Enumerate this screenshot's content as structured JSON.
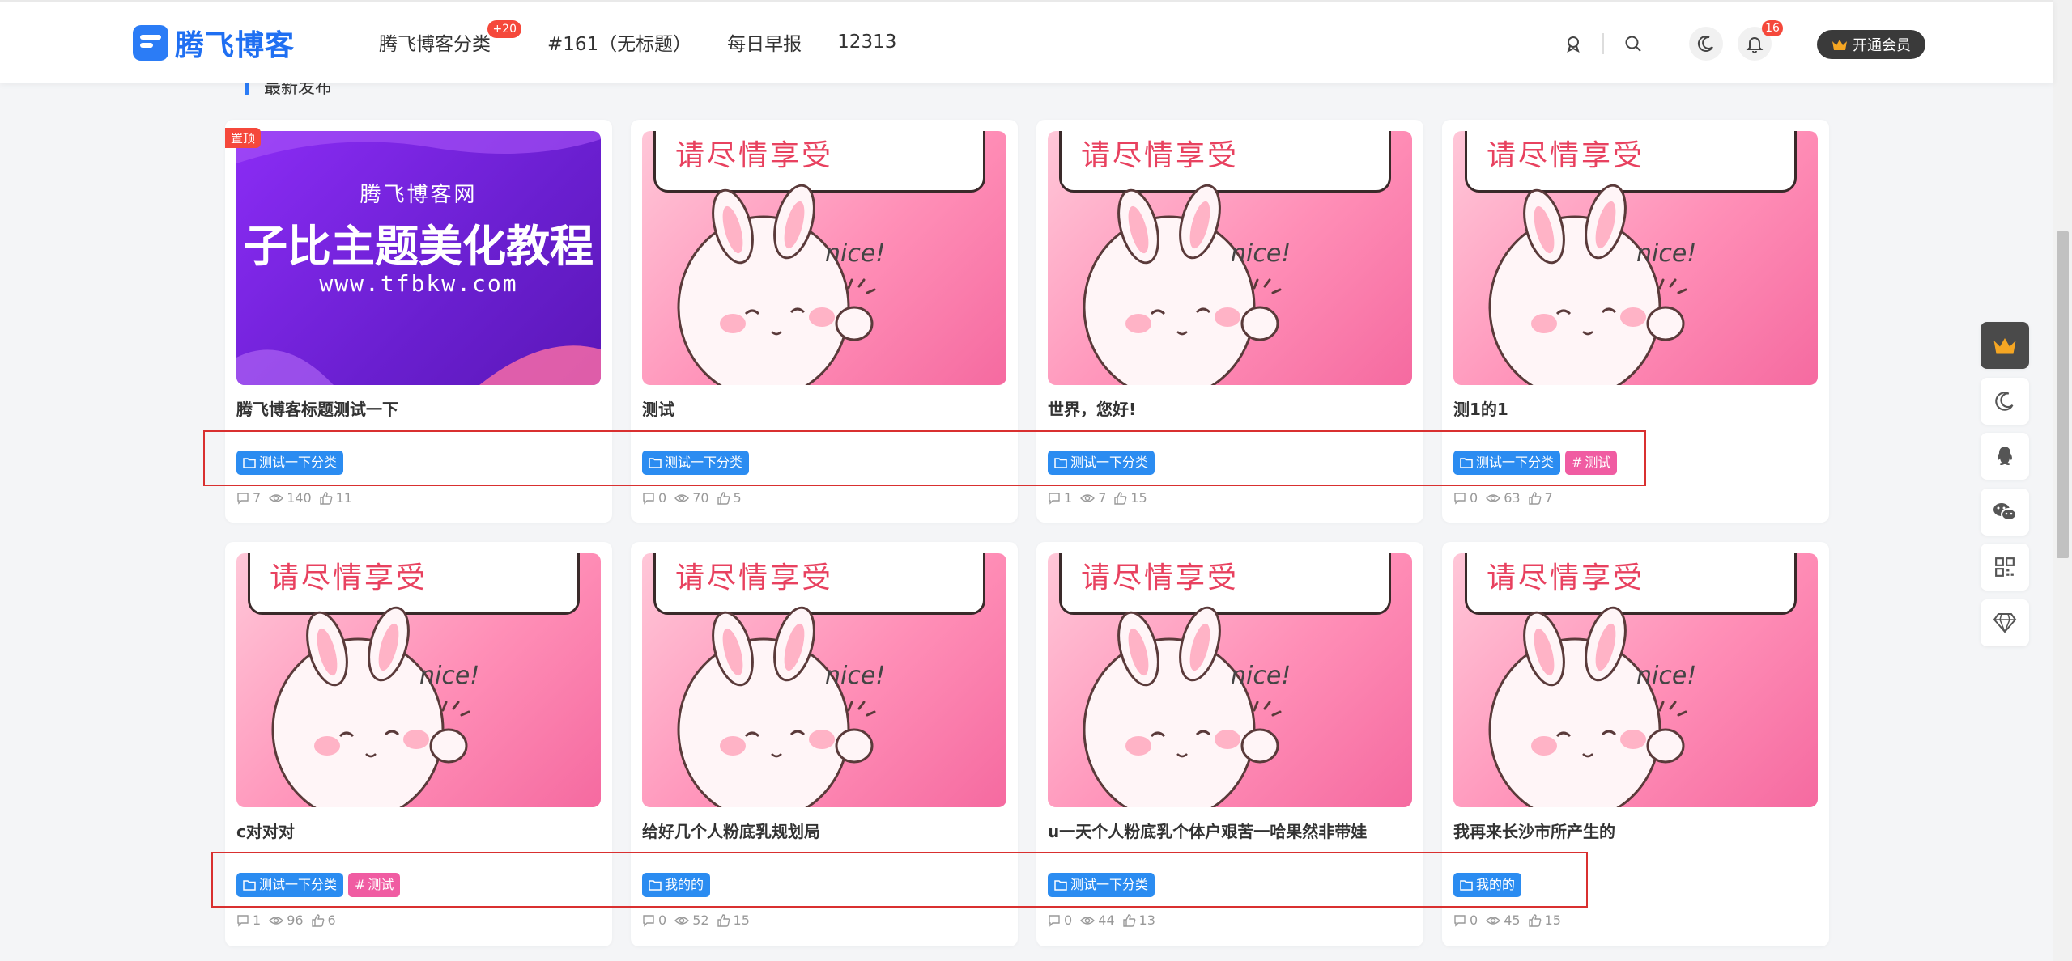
{
  "header": {
    "logo_text": "腾飞博客",
    "nav": [
      {
        "label": "腾飞博客分类",
        "badge": "+20"
      },
      {
        "label": "#161（无标题）"
      },
      {
        "label": "每日早报"
      },
      {
        "label": "12313"
      }
    ],
    "notification_count": "16",
    "vip_label": "开通会员"
  },
  "section": {
    "title": "最新发布"
  },
  "cards": [
    {
      "title": "腾飞博客标题测试一下",
      "pinned": "置顶",
      "thumb": "promo",
      "promo": {
        "line1": "腾飞博客网",
        "line2": "子比主题美化教程",
        "line3": "www.tfbkw.com"
      },
      "tags": [
        {
          "label": "测试一下分类",
          "color": "blue"
        }
      ],
      "comments": "7",
      "views": "140",
      "likes": "11"
    },
    {
      "title": "测试",
      "thumb": "bunny",
      "tags": [
        {
          "label": "测试一下分类",
          "color": "blue"
        }
      ],
      "comments": "0",
      "views": "70",
      "likes": "5"
    },
    {
      "title": "世界，您好!",
      "thumb": "bunny",
      "tags": [
        {
          "label": "测试一下分类",
          "color": "blue"
        }
      ],
      "comments": "1",
      "views": "7",
      "likes": "15"
    },
    {
      "title": "测1的1",
      "thumb": "bunny",
      "tags": [
        {
          "label": "测试一下分类",
          "color": "blue"
        },
        {
          "label": "测试",
          "color": "pink"
        }
      ],
      "comments": "0",
      "views": "63",
      "likes": "7"
    },
    {
      "title": "c对对对",
      "thumb": "bunny",
      "tags": [
        {
          "label": "测试一下分类",
          "color": "blue"
        },
        {
          "label": "测试",
          "color": "pink"
        }
      ],
      "comments": "1",
      "views": "96",
      "likes": "6"
    },
    {
      "title": "给好几个人粉底乳规划局",
      "thumb": "bunny",
      "tags": [
        {
          "label": "我的的",
          "color": "blue"
        }
      ],
      "comments": "0",
      "views": "52",
      "likes": "15"
    },
    {
      "title": "u一天个人粉底乳个体户艰苦一哈果然非带娃",
      "thumb": "bunny",
      "tags": [
        {
          "label": "测试一下分类",
          "color": "blue"
        }
      ],
      "comments": "0",
      "views": "44",
      "likes": "13"
    },
    {
      "title": "我再来长沙市所产生的",
      "thumb": "bunny",
      "tags": [
        {
          "label": "我的的",
          "color": "blue"
        }
      ],
      "comments": "0",
      "views": "45",
      "likes": "15"
    }
  ],
  "bunny_art": {
    "bubble_text": "请尽情享受",
    "nice": "nice!"
  },
  "colors": {
    "accent": "#2b7cf6",
    "tag_blue": "#2b8cf1",
    "tag_pink": "#f05ca2",
    "badge_red": "#f5483b"
  }
}
